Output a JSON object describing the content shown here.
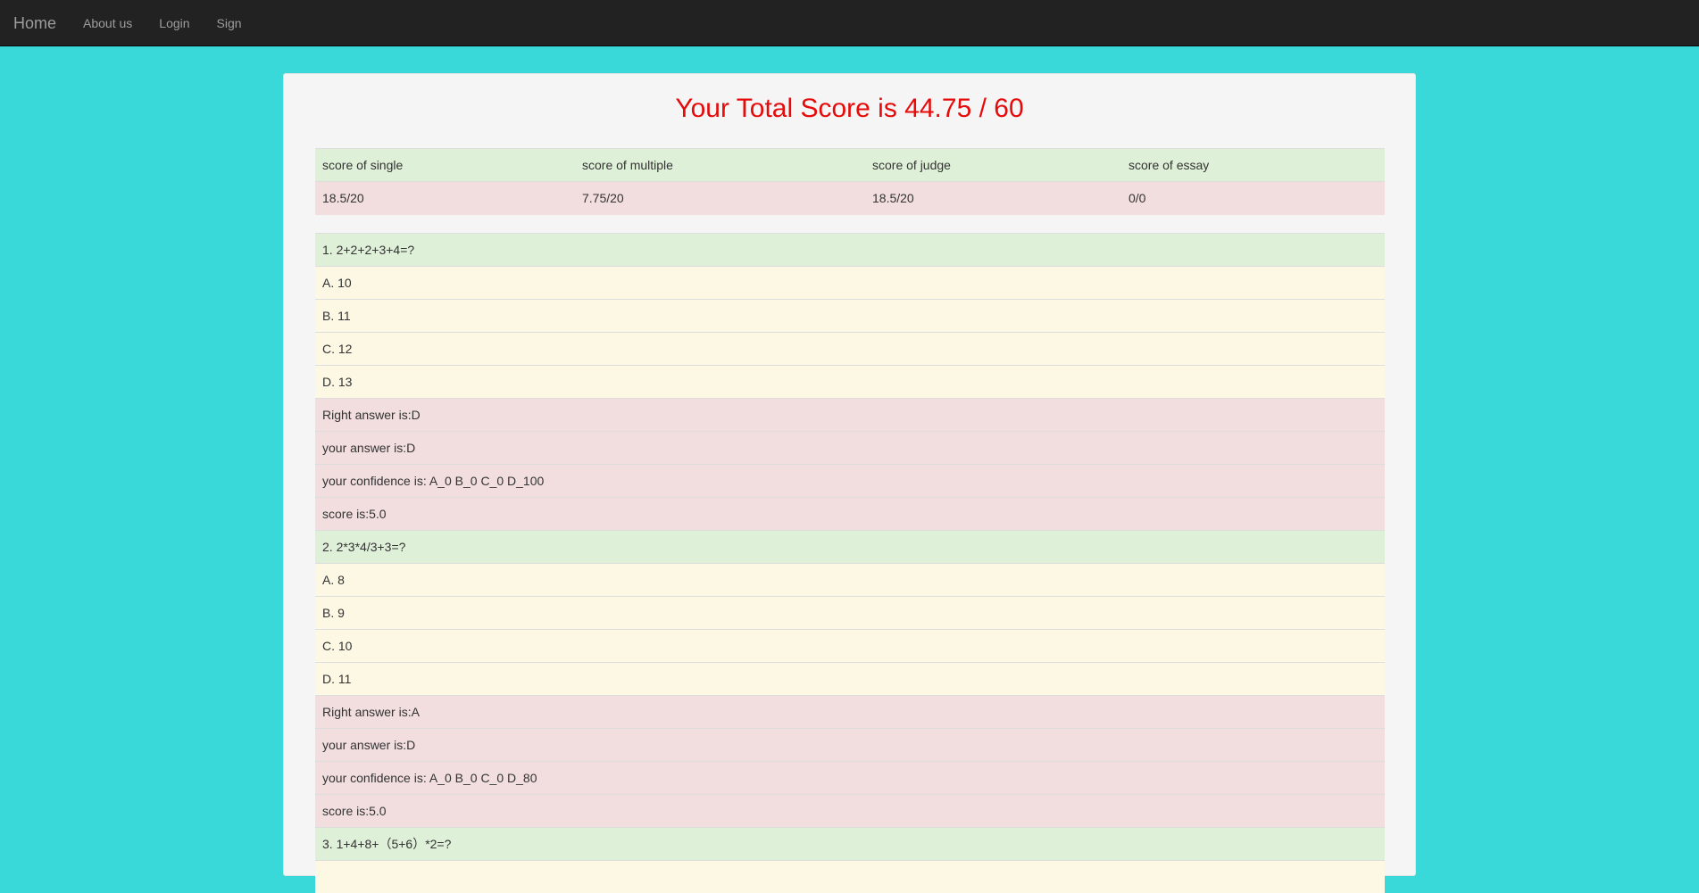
{
  "nav": {
    "brand": "Home",
    "links": [
      "About us",
      "Login",
      "Sign"
    ]
  },
  "total": {
    "title": "Your Total Score is 44.75 / 60"
  },
  "summary": {
    "headers": [
      "score of single",
      "score of multiple",
      "score of judge",
      "score of essay"
    ],
    "values": [
      "18.5/20",
      "7.75/20",
      "18.5/20",
      "0/0"
    ]
  },
  "questions": [
    {
      "question": "1. 2+2+2+3+4=?",
      "options": [
        "A. 10",
        "B. 11",
        "C. 12",
        "D. 13"
      ],
      "right_answer": "Right answer is:D",
      "your_answer": "your answer is:D",
      "confidence": "your confidence is: A_0 B_0 C_0 D_100",
      "score": "score is:5.0"
    },
    {
      "question": "2. 2*3*4/3+3=?",
      "options": [
        "A. 8",
        "B. 9",
        "C. 10",
        "D. 11"
      ],
      "right_answer": "Right answer is:A",
      "your_answer": "your answer is:D",
      "confidence": "your confidence is: A_0 B_0 C_0 D_80",
      "score": "score is:5.0"
    },
    {
      "question": "3. 1+4+8+（5+6）*2=?"
    }
  ],
  "colors": {
    "background": "#39d8d9",
    "navbar": "#222222",
    "title_red": "#e60b0b",
    "success_row": "#dff0d8",
    "warning_row": "#fcf8e3",
    "danger_row": "#f2dede"
  }
}
